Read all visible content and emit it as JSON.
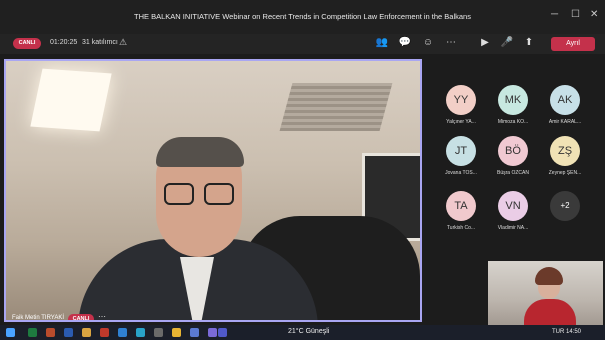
{
  "window": {
    "title": "THE BALKAN INITIATIVE Webinar on Recent Trends in Competition Law Enforcement in the Balkans"
  },
  "toolbar": {
    "live_label": "CANLI",
    "timer": "01:20:25",
    "participants_count": "31 katılımcı",
    "leave_label": "Ayrıl"
  },
  "presenter": {
    "name": "Faik Metin TIRYAKİ",
    "live_label": "CANLI"
  },
  "tiles": [
    {
      "initials": "YY",
      "name": "Yalçıner YA...",
      "color": "#f2cfc7"
    },
    {
      "initials": "MK",
      "name": "Mimoza KO...",
      "color": "#c7e8e0"
    },
    {
      "initials": "AK",
      "name": "Amir KARAL...",
      "color": "#c7e0e8"
    },
    {
      "initials": "JT",
      "name": "Jovana TOS...",
      "color": "#c7e0e4"
    },
    {
      "initials": "BÖ",
      "name": "Büşra ÖZCAN",
      "color": "#f0c9d2"
    },
    {
      "initials": "ZŞ",
      "name": "Zeynep ŞEN...",
      "color": "#f0e2b5"
    },
    {
      "initials": "TA",
      "name": "Turkish Co...",
      "color": "#f0c9cd"
    },
    {
      "initials": "VN",
      "name": "Vladimir NA...",
      "color": "#eacde6"
    }
  ],
  "more_participants": "+2",
  "taskbar": {
    "weather": "21°C Güneşli",
    "language": "TUR",
    "clock": "14:50"
  },
  "colors": {
    "accent": "#a9a6f2",
    "live": "#c4314b"
  }
}
